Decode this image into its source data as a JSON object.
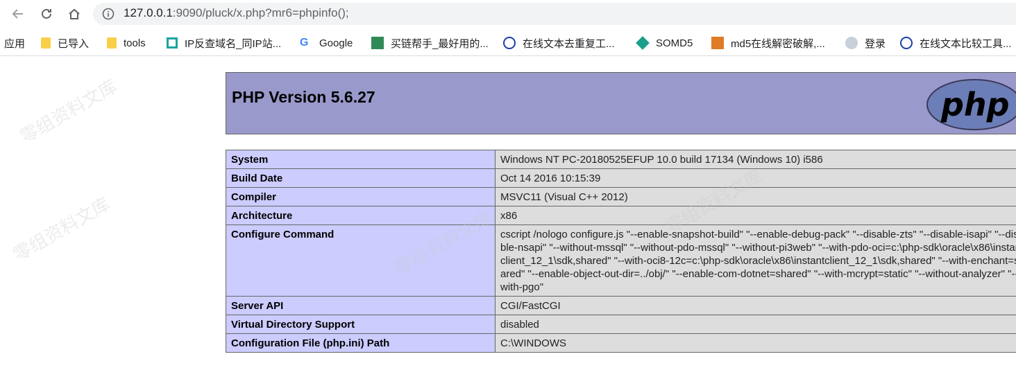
{
  "browser": {
    "url_host": "127.0.0.1",
    "url_rest": ":9090/pluck/x.php?mr6=phpinfo();"
  },
  "bookmarks": [
    {
      "label": "应用",
      "icon": "apps-icon"
    },
    {
      "label": "已导入",
      "icon": "folder-icon"
    },
    {
      "label": "tools",
      "icon": "folder-icon"
    },
    {
      "label": "IP反查域名_同IP站...",
      "icon": "ip-site-icon"
    },
    {
      "label": "Google",
      "icon": "google-icon"
    },
    {
      "label": "买链帮手_最好用的...",
      "icon": "link-helper-icon"
    },
    {
      "label": "在线文本去重复工...",
      "icon": "text-tool-icon"
    },
    {
      "label": "SOMD5",
      "icon": "somd5-icon"
    },
    {
      "label": "md5在线解密破解,...",
      "icon": "md5-icon"
    },
    {
      "label": "登录",
      "icon": "login-icon"
    },
    {
      "label": "在线文本比较工具...",
      "icon": "text-compare-icon"
    }
  ],
  "page": {
    "title": "PHP Version 5.6.27",
    "rows": [
      {
        "key": "System",
        "value": "Windows NT PC-20180525EFUP 10.0 build 17134 (Windows 10) i586"
      },
      {
        "key": "Build Date",
        "value": "Oct 14 2016 10:15:39"
      },
      {
        "key": "Compiler",
        "value": "MSVC11 (Visual C++ 2012)"
      },
      {
        "key": "Architecture",
        "value": "x86"
      },
      {
        "key": "Configure Command",
        "value": "cscript /nologo configure.js \"--enable-snapshot-build\" \"--enable-debug-pack\" \"--disable-zts\" \"--disable-isapi\" \"--disable-nsapi\" \"--without-mssql\" \"--without-pdo-mssql\" \"--without-pi3web\" \"--with-pdo-oci=c:\\php-sdk\\oracle\\x86\\instantclient_12_1\\sdk,shared\" \"--with-oci8-12c=c:\\php-sdk\\oracle\\x86\\instantclient_12_1\\sdk,shared\" \"--with-enchant=shared\" \"--enable-object-out-dir=../obj/\" \"--enable-com-dotnet=shared\" \"--with-mcrypt=static\" \"--without-analyzer\" \"--with-pgo\""
      },
      {
        "key": "Server API",
        "value": "CGI/FastCGI"
      },
      {
        "key": "Virtual Directory Support",
        "value": "disabled"
      },
      {
        "key": "Configuration File (php.ini) Path",
        "value": "C:\\WINDOWS"
      }
    ]
  },
  "watermark": "零组资料文库"
}
